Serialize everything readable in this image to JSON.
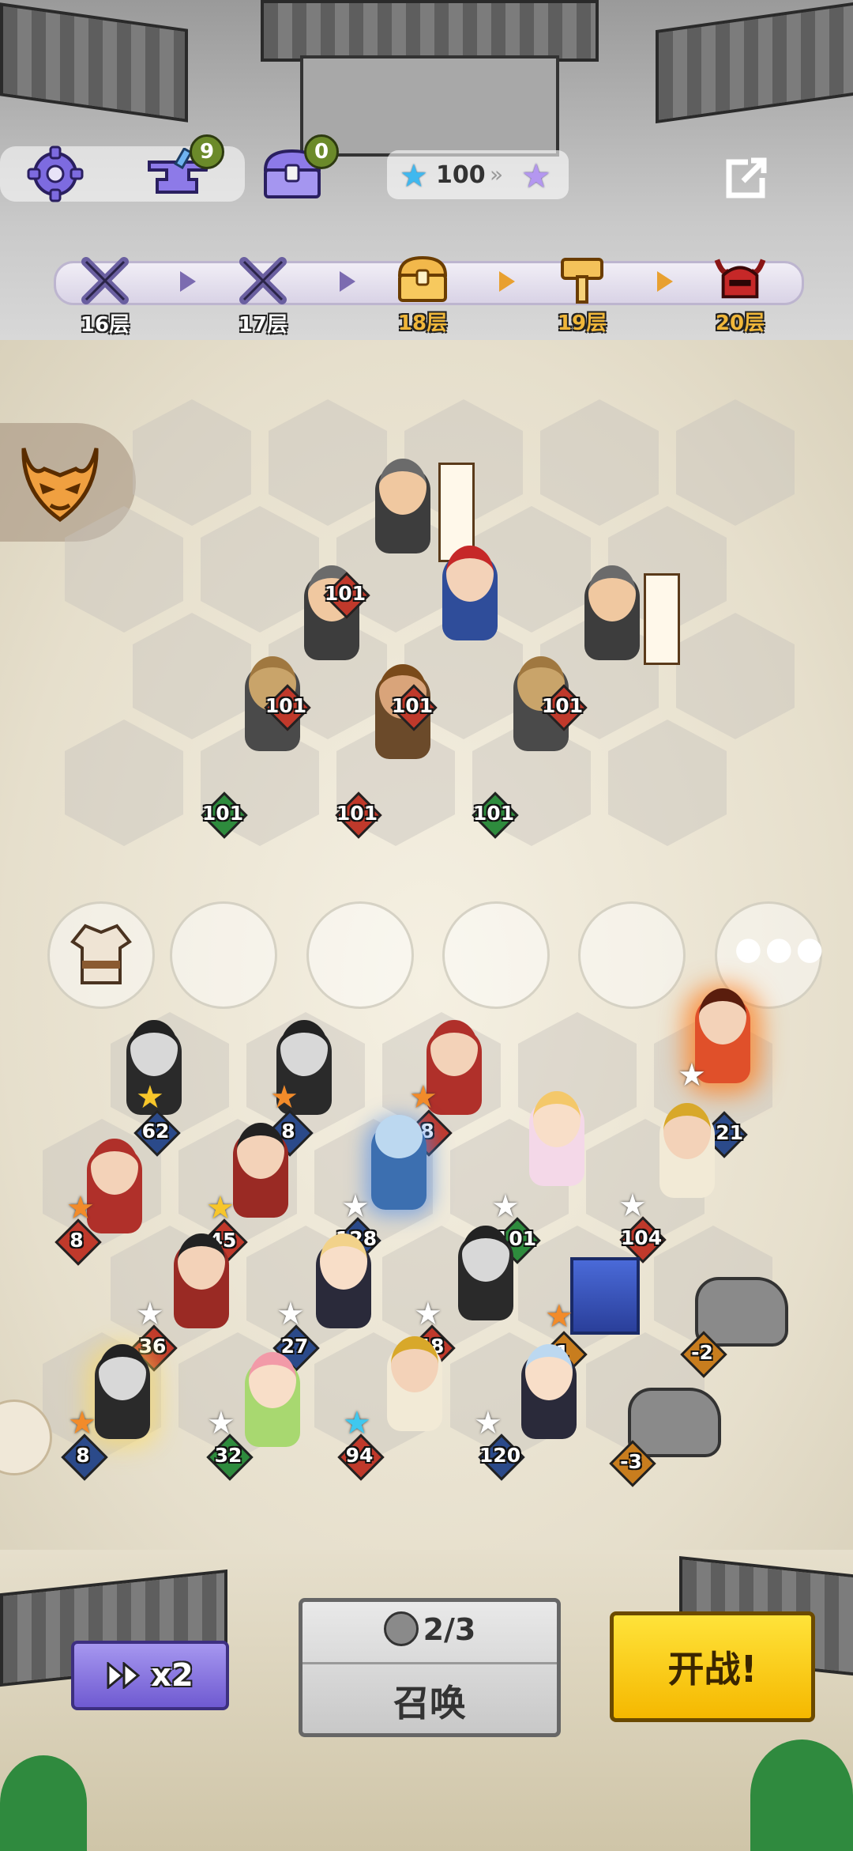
{
  "topbar": {
    "anvil_count": "9",
    "chest_count": "0",
    "star_value": "100"
  },
  "stages": [
    {
      "label": "16层",
      "state": "done",
      "icon": "crossed-swords-icon"
    },
    {
      "label": "17层",
      "state": "done",
      "icon": "crossed-swords-icon"
    },
    {
      "label": "18层",
      "state": "current",
      "icon": "treasure-chest-icon"
    },
    {
      "label": "19层",
      "state": "next",
      "icon": "hammer-icon"
    },
    {
      "label": "20层",
      "state": "boss",
      "icon": "boss-helmet-icon"
    }
  ],
  "enemies": [
    {
      "level": "101",
      "gem": "#c0392b"
    },
    {
      "level": "101",
      "gem": "#c0392b"
    },
    {
      "level": "101",
      "gem": "#c0392b"
    },
    {
      "level": "101",
      "gem": "#c0392b"
    },
    {
      "level": "101",
      "gem": "#2e8b3d"
    },
    {
      "level": "101",
      "gem": "#c0392b"
    },
    {
      "level": "101",
      "gem": "#2e8b3d"
    }
  ],
  "heroes": [
    {
      "level": "121",
      "star": "white",
      "gem": "#2b4a8a"
    },
    {
      "level": "62",
      "star": "gold",
      "gem": "#2b4a8a"
    },
    {
      "level": "8",
      "star": "orange",
      "gem": "#2b4a8a"
    },
    {
      "level": "8",
      "star": "orange",
      "gem": "#c0392b"
    },
    {
      "level": "8",
      "star": "orange",
      "gem": "#c0392b"
    },
    {
      "level": "45",
      "star": "gold",
      "gem": "#c0392b"
    },
    {
      "level": "128",
      "star": "white",
      "gem": "#2b4a8a"
    },
    {
      "level": "101",
      "star": "white",
      "gem": "#2e8b3d"
    },
    {
      "level": "104",
      "star": "white",
      "gem": "#c0392b"
    },
    {
      "level": "36",
      "star": "white",
      "gem": "#c0392b"
    },
    {
      "level": "27",
      "star": "white",
      "gem": "#2b4a8a"
    },
    {
      "level": "48",
      "star": "white",
      "gem": "#c0392b"
    },
    {
      "level": "1",
      "star": "orange",
      "gem": "#c87d1e"
    },
    {
      "level": "-2",
      "star": "",
      "gem": "#c87d1e"
    },
    {
      "level": "8",
      "star": "orange",
      "gem": "#2b4a8a"
    },
    {
      "level": "32",
      "star": "white",
      "gem": "#2e8b3d"
    },
    {
      "level": "94",
      "star": "cyan",
      "gem": "#c0392b"
    },
    {
      "level": "120",
      "star": "white",
      "gem": "#2b4a8a"
    },
    {
      "level": "-3",
      "star": "",
      "gem": "#c87d1e"
    }
  ],
  "controls": {
    "speed_label": "x2",
    "summon_count": "2/3",
    "summon_label": "召唤",
    "fight_label": "开战!"
  }
}
